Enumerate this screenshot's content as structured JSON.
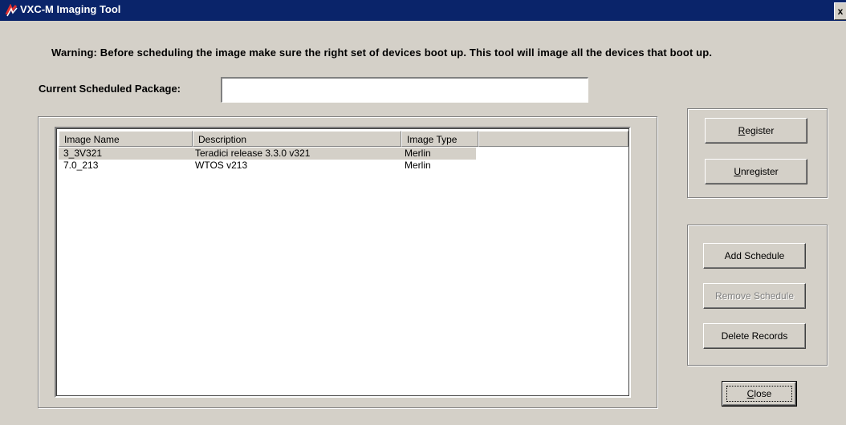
{
  "window": {
    "title": "VXC-M Imaging Tool",
    "close_glyph": "x"
  },
  "warning_text": "Warning: Before scheduling the image make sure the right set of devices boot up. This tool will image all the devices that boot up.",
  "package": {
    "label": "Current Scheduled Package:",
    "value": ""
  },
  "list": {
    "columns": [
      "Image Name",
      "Description",
      "Image Type",
      ""
    ],
    "rows": [
      {
        "name": "3_3V321",
        "description": "Teradici release 3.3.0 v321",
        "type": "Merlin",
        "selected": true
      },
      {
        "name": "7.0_213",
        "description": "WTOS v213",
        "type": "Merlin",
        "selected": false
      }
    ]
  },
  "buttons": {
    "register": {
      "access_key": "R",
      "rest": "egister"
    },
    "unregister": {
      "access_key": "U",
      "rest": "nregister"
    },
    "add_schedule": "Add Schedule",
    "remove_schedule": "Remove Schedule",
    "delete_records": "Delete Records",
    "close": {
      "access_key": "C",
      "rest": "lose"
    }
  },
  "colors": {
    "titlebar": "#0a246a",
    "face": "#d4d0c8",
    "selection": "#d4d0c8"
  }
}
